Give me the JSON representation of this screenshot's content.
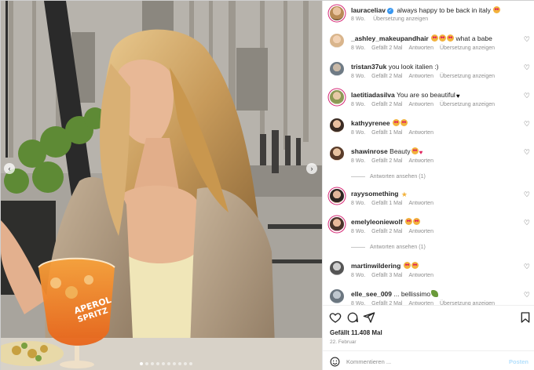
{
  "post": {
    "author": "lauraceliav",
    "caption": "always happy to be back in italy",
    "caption_age": "8 Wo.",
    "translate": "Übersetzung anzeigen"
  },
  "photo": {
    "sign_line1": "APEROL",
    "sign_line2": "SPRITZ",
    "dots_count": 10,
    "active_dot": 0
  },
  "comments": [
    {
      "user": "_ashley_makeupandhair",
      "text": "what a babe",
      "emoji_before": [
        "heart-eyes",
        "heart-eyes",
        "heart-eyes"
      ],
      "emoji_after": [],
      "age": "8 Wo.",
      "likes": "Gefällt 2 Mal",
      "reply": "Antworten",
      "translate": "Übersetzung anzeigen",
      "ring": false
    },
    {
      "user": "tristan37uk",
      "text": "you look italien :)",
      "emoji_before": [],
      "emoji_after": [],
      "age": "8 Wo.",
      "likes": "Gefällt 2 Mal",
      "reply": "Antworten",
      "translate": "Übersetzung anzeigen",
      "ring": false
    },
    {
      "user": "laetitiadasilva",
      "text": "You are so beautiful",
      "emoji_before": [],
      "emoji_after": [
        "blackheart"
      ],
      "age": "8 Wo.",
      "likes": "Gefällt 2 Mal",
      "reply": "Antworten",
      "translate": "Übersetzung anzeigen",
      "ring": true
    },
    {
      "user": "kathyyrenee",
      "text": "",
      "emoji_before": [
        "heart-eyes",
        "heart-eyes"
      ],
      "emoji_after": [],
      "age": "8 Wo.",
      "likes": "Gefällt 1 Mal",
      "reply": "Antworten",
      "translate": "",
      "ring": false
    },
    {
      "user": "shawinrose",
      "text": "Beauty",
      "emoji_before": [],
      "emoji_after": [
        "heart-eyes",
        "redheart"
      ],
      "age": "8 Wo.",
      "likes": "Gefällt 2 Mal",
      "reply": "Antworten",
      "translate": "",
      "ring": false,
      "replies": "Antworten ansehen (1)"
    },
    {
      "user": "rayysomething",
      "text": "",
      "emoji_before": [
        "star"
      ],
      "emoji_after": [],
      "age": "8 Wo.",
      "likes": "Gefällt 1 Mal",
      "reply": "Antworten",
      "translate": "",
      "ring": true
    },
    {
      "user": "emelyleoniewolf",
      "text": "",
      "emoji_before": [
        "heart-eyes",
        "heart-eyes"
      ],
      "emoji_after": [],
      "age": "8 Wo.",
      "likes": "Gefällt 2 Mal",
      "reply": "Antworten",
      "translate": "",
      "ring": true,
      "replies": "Antworten ansehen (1)"
    },
    {
      "user": "martinwildering",
      "text": "",
      "emoji_before": [
        "heart-eyes",
        "heart-eyes"
      ],
      "emoji_after": [],
      "age": "8 Wo.",
      "likes": "Gefällt 3 Mal",
      "reply": "Antworten",
      "translate": "",
      "ring": false
    },
    {
      "user": "elle_see_009",
      "text": "... bellissimo",
      "emoji_before": [],
      "emoji_after": [
        "plant"
      ],
      "age": "8 Wo.",
      "likes": "Gefällt 2 Mal",
      "reply": "Antworten",
      "translate": "Übersetzung anzeigen",
      "ring": false
    }
  ],
  "actions": {
    "like_icon": "heart-icon",
    "comment_icon": "comment-icon",
    "share_icon": "send-icon",
    "save_icon": "bookmark-icon",
    "likes_count": "Gefällt 11.408 Mal",
    "date": "22. Februar",
    "add_comment_placeholder": "Kommentieren ...",
    "post_label": "Posten"
  },
  "colors": {
    "story_ring": "#d62976",
    "verified": "#3897f0",
    "post_button_disabled": "#b2dffc"
  }
}
